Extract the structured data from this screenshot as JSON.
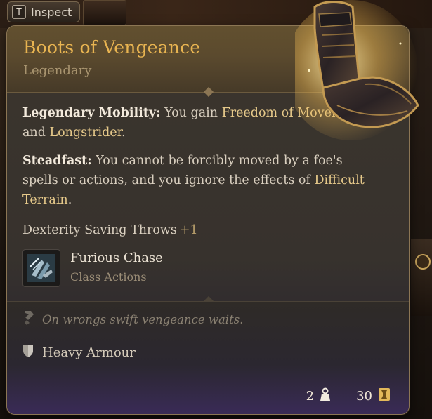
{
  "inspect": {
    "key": "T",
    "label": "Inspect"
  },
  "item": {
    "name": "Boots of Vengeance",
    "rarity": "Legendary",
    "abilities": [
      {
        "name": "Legendary Mobility:",
        "text_1": " You gain ",
        "link_1": "Freedom of Movement",
        "text_2": " and ",
        "link_2": "Longstrider",
        "text_3": "."
      },
      {
        "name": "Steadfast:",
        "text_1": " You cannot be forcibly moved by a foe's spells or actions, and you ignore the effects of ",
        "link_1": "Difficult Terrain",
        "text_2": "."
      }
    ],
    "bonus": {
      "label": "Dexterity Saving Throws",
      "value": "+1"
    },
    "action": {
      "name": "Furious Chase",
      "category": "Class Actions",
      "icon": "furious-chase-icon"
    },
    "flavor_text": "On wrongs swift vengeance waits.",
    "armour_type": "Heavy Armour",
    "weight": "2",
    "value": "30"
  },
  "colors": {
    "title": "#e8b451",
    "highlight": "#e6c98a",
    "rarity": "#a8946f"
  }
}
